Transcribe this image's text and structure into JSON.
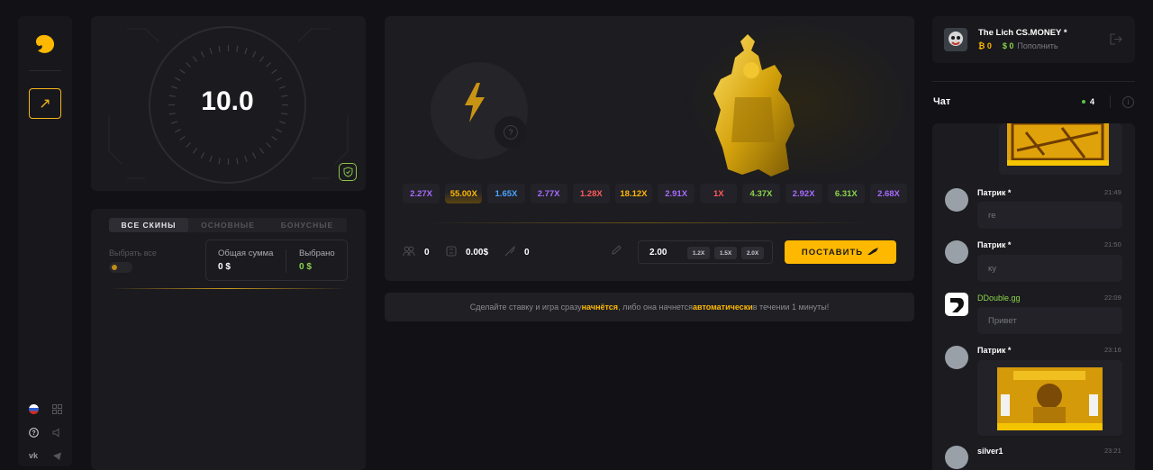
{
  "timer": {
    "value": "10.0"
  },
  "skins": {
    "tabs": [
      "ВСЕ СКИНЫ",
      "ОСНОВНЫЕ",
      "БОНУСНЫЕ"
    ],
    "select_all": "Выбрать все",
    "total_label": "Общая сумма",
    "total_value": "0 $",
    "selected_label": "Выбрано",
    "selected_value": "0 $"
  },
  "game": {
    "multipliers": [
      {
        "label": "2.27X",
        "color": "#a86bff"
      },
      {
        "label": "55.00X",
        "color": "#ffb800"
      },
      {
        "label": "1.65X",
        "color": "#4aa3ff"
      },
      {
        "label": "2.77X",
        "color": "#a86bff"
      },
      {
        "label": "1.28X",
        "color": "#ff5a5a"
      },
      {
        "label": "18.12X",
        "color": "#ffb800"
      },
      {
        "label": "2.91X",
        "color": "#a86bff"
      },
      {
        "label": "1X",
        "color": "#ff5a5a"
      },
      {
        "label": "4.37X",
        "color": "#8bd44a"
      },
      {
        "label": "2.92X",
        "color": "#a86bff"
      },
      {
        "label": "6.31X",
        "color": "#8bd44a"
      },
      {
        "label": "2.68X",
        "color": "#a86bff"
      }
    ],
    "players": "0",
    "bank": "0.00$",
    "items": "0",
    "bet_value": "2.00",
    "bet_mults": [
      "1.2X",
      "1.5X",
      "2.0X"
    ],
    "place_label": "ПОСТАВИТЬ"
  },
  "info": {
    "part1": "Сделайте ставку и игра сразу ",
    "hl1": "начнётся",
    "part2": ", либо она начнется ",
    "hl2": "автоматически",
    "part3": " в течении 1 минуты!"
  },
  "user": {
    "name": "The Lich CS.MONEY *",
    "coins": "0",
    "dollars": "$ 0",
    "topup": "Пополнить"
  },
  "chat": {
    "title": "Чат",
    "online": "4",
    "messages": [
      {
        "name": "Патрик *",
        "time": "21:49",
        "text": "ге",
        "name_color": "#ffffff"
      },
      {
        "name": "Патрик *",
        "time": "21:50",
        "text": "ку",
        "name_color": "#ffffff"
      },
      {
        "name": "DDouble.gg",
        "time": "22:09",
        "text": "Привет",
        "name_color": "#8bd44a"
      },
      {
        "name": "Патрик *",
        "time": "23:16",
        "text": "",
        "name_color": "#ffffff"
      },
      {
        "name": "silver1",
        "time": "23:21",
        "text": "",
        "name_color": "#ffffff"
      }
    ]
  },
  "colors": {
    "accent": "#ffb800",
    "success": "#8bd44a",
    "panel": "#1a1a1f",
    "background": "#121216"
  }
}
